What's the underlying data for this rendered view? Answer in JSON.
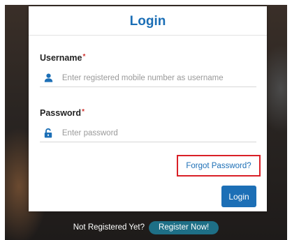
{
  "colors": {
    "accent": "#1c6fb6",
    "required": "#d0312d",
    "highlight_border": "#d92027",
    "register_button": "#1e6f86"
  },
  "card": {
    "title": "Login"
  },
  "username": {
    "label": "Username",
    "required_mark": "*",
    "placeholder": "Enter registered mobile number as username",
    "value": "",
    "icon": "user-icon"
  },
  "password": {
    "label": "Password",
    "required_mark": "*",
    "placeholder": "Enter password",
    "value": "",
    "icon": "unlock-icon"
  },
  "forgot_password": {
    "label": "Forgot Password?"
  },
  "login_button": {
    "label": "Login"
  },
  "footer": {
    "prompt": "Not Registered Yet?",
    "register_label": "Register Now!"
  }
}
